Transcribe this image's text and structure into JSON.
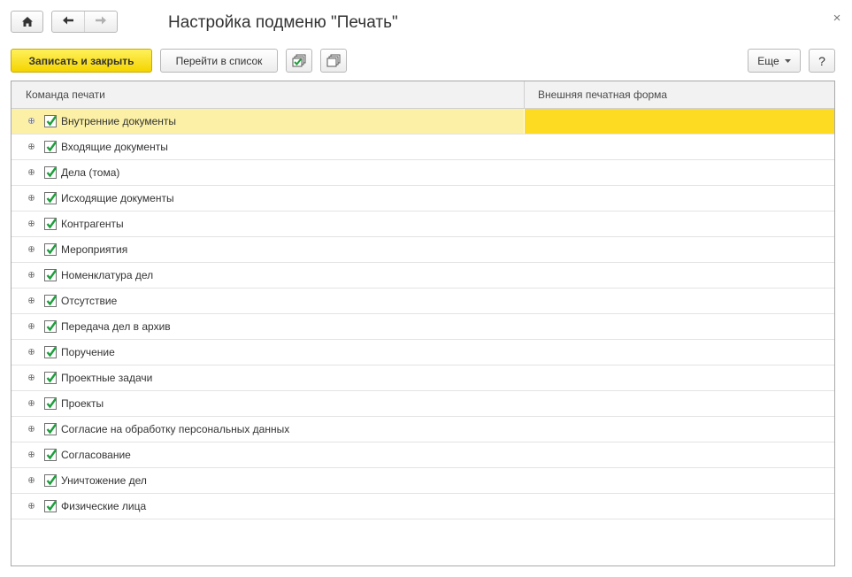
{
  "window": {
    "title": "Настройка подменю \"Печать\"",
    "close_glyph": "×"
  },
  "toolbar": {
    "save_close_label": "Записать и закрыть",
    "goto_list_label": "Перейти в список",
    "more_label": "Еще",
    "help_label": "?"
  },
  "table": {
    "columns": [
      "Команда печати",
      "Внешняя печатная форма"
    ],
    "rows": [
      {
        "label": "Внутренние документы",
        "checked": true,
        "selected": true
      },
      {
        "label": "Входящие документы",
        "checked": true
      },
      {
        "label": "Дела (тома)",
        "checked": true
      },
      {
        "label": "Исходящие документы",
        "checked": true
      },
      {
        "label": "Контрагенты",
        "checked": true
      },
      {
        "label": "Мероприятия",
        "checked": true
      },
      {
        "label": "Номенклатура дел",
        "checked": true
      },
      {
        "label": "Отсутствие",
        "checked": true
      },
      {
        "label": "Передача дел в архив",
        "checked": true
      },
      {
        "label": "Поручение",
        "checked": true
      },
      {
        "label": "Проектные задачи",
        "checked": true
      },
      {
        "label": "Проекты",
        "checked": true
      },
      {
        "label": "Согласие на обработку персональных данных",
        "checked": true
      },
      {
        "label": "Согласование",
        "checked": true
      },
      {
        "label": "Уничтожение дел",
        "checked": true
      },
      {
        "label": "Физические лица",
        "checked": true
      }
    ]
  },
  "colors": {
    "primary_button": "#f4d400",
    "selected_row": "#fbf0a6",
    "selected_cell": "#fcdb22",
    "checkmark": "#1e9e3c"
  },
  "icons": {
    "home": "home-icon",
    "back": "arrow-left-icon",
    "forward": "arrow-right-icon",
    "check_all": "check-all-icon",
    "uncheck_all": "uncheck-all-icon",
    "dropdown": "chevron-down-icon",
    "expand": "expand-icon",
    "checkbox": "checkbox-icon"
  }
}
